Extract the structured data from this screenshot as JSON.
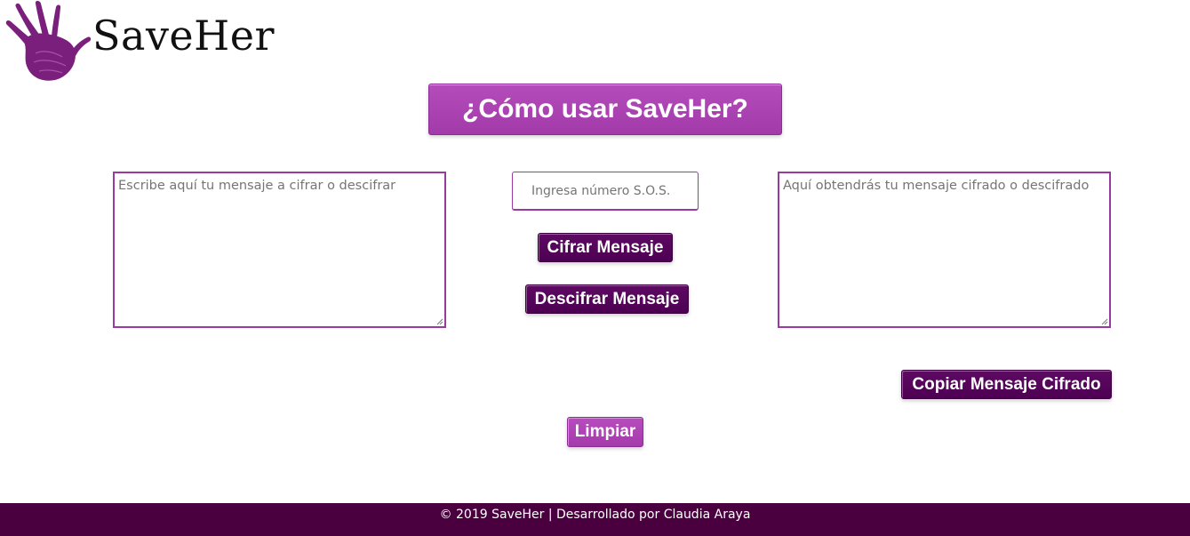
{
  "brand": {
    "name": "SaveHer",
    "logo_icon": "hand-print-icon",
    "accent_color": "#a83db0",
    "dark_color": "#4d0052",
    "footer_color": "#4a003f"
  },
  "howto_button": {
    "label": "¿Cómo usar SaveHer?"
  },
  "input_message": {
    "value": "",
    "placeholder": "Escribe aquí tu mensaje a cifrar o descifrar"
  },
  "sos_number": {
    "value": "",
    "placeholder": "Ingresa número S.O.S."
  },
  "output_message": {
    "value": "",
    "placeholder": "Aquí obtendrás tu mensaje cifrado o descifrado"
  },
  "buttons": {
    "encrypt": "Cifrar Mensaje",
    "decrypt": "Descifrar Mensaje",
    "copy": "Copiar Mensaje Cifrado",
    "clear": "Limpiar"
  },
  "footer": {
    "text": "© 2019 SaveHer | Desarrollado por Claudia Araya"
  }
}
